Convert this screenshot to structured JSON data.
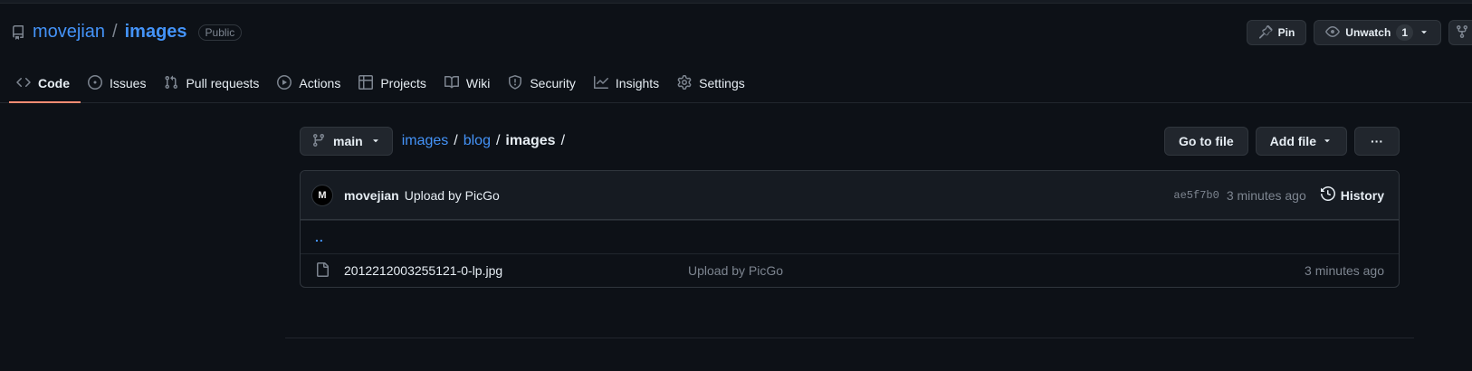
{
  "repo": {
    "owner": "movejian",
    "separator": "/",
    "name": "images",
    "visibility": "Public"
  },
  "actions": {
    "pin_label": "Pin",
    "unwatch_label": "Unwatch",
    "watch_count": "1"
  },
  "nav": {
    "items": [
      {
        "label": "Code",
        "icon": "code-icon",
        "active": true
      },
      {
        "label": "Issues",
        "icon": "issue-opened-icon"
      },
      {
        "label": "Pull requests",
        "icon": "git-pull-request-icon"
      },
      {
        "label": "Actions",
        "icon": "play-icon"
      },
      {
        "label": "Projects",
        "icon": "table-icon"
      },
      {
        "label": "Wiki",
        "icon": "book-icon"
      },
      {
        "label": "Security",
        "icon": "shield-icon"
      },
      {
        "label": "Insights",
        "icon": "graph-icon"
      },
      {
        "label": "Settings",
        "icon": "gear-icon"
      }
    ]
  },
  "browser": {
    "branch": "main",
    "breadcrumb": [
      "images",
      "blog",
      "images"
    ],
    "sep": "/",
    "go_to_file": "Go to file",
    "add_file": "Add file",
    "more": "···"
  },
  "commit": {
    "avatar_initial": "M",
    "author": "movejian",
    "message": "Upload by PicGo",
    "sha": "ae5f7b0",
    "age": "3 minutes ago",
    "history_label": "History"
  },
  "files": {
    "parent": "..",
    "rows": [
      {
        "name": "2012212003255121-0-lp.jpg",
        "message": "Upload by PicGo",
        "age": "3 minutes ago",
        "icon": "file-icon"
      }
    ]
  },
  "colors": {
    "background": "#0d1117",
    "link": "#4493f8",
    "active_underline": "#fd8c73",
    "border": "#30363d",
    "muted": "#7d8590"
  }
}
